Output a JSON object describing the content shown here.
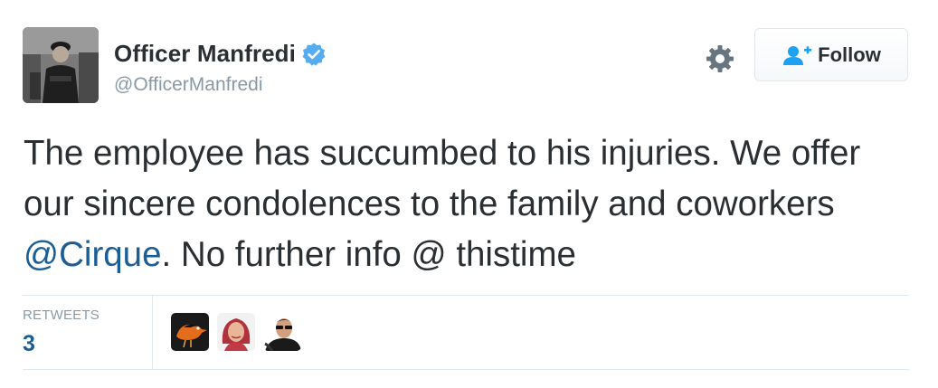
{
  "author": {
    "display_name": "Officer Manfredi",
    "screen_name": "@OfficerManfredi",
    "verified": true,
    "avatar_icon": "police-officer-avatar"
  },
  "actions": {
    "settings_icon": "gear-icon",
    "follow_label": "Follow",
    "follow_icon": "add-user-icon"
  },
  "tweet": {
    "text_before": "The employee has succumbed to his injuries. We offer our sincere condolences to the family and coworkers ",
    "mention": "@Cirque",
    "text_after": ". No further info @ thistime"
  },
  "stats": {
    "retweets_label": "RETWEETS",
    "retweets_count": "3",
    "retweeter_avatars": [
      "oriole-bird-avatar",
      "woman-avatar",
      "man-sunglasses-avatar"
    ]
  },
  "colors": {
    "text": "#292f33",
    "muted": "#8899a6",
    "link": "#1b5e95",
    "verified_blue": "#55acee",
    "border": "#e1e8ed"
  }
}
